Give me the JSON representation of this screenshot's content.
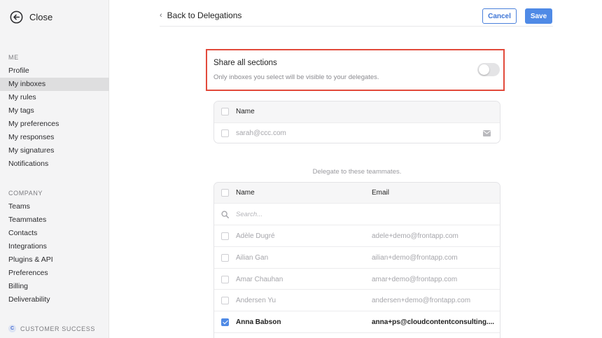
{
  "sidebar": {
    "close_label": "Close",
    "me_label": "ME",
    "me_items": [
      {
        "label": "Profile",
        "active": false
      },
      {
        "label": "My inboxes",
        "active": true
      },
      {
        "label": "My rules",
        "active": false
      },
      {
        "label": "My tags",
        "active": false
      },
      {
        "label": "My preferences",
        "active": false
      },
      {
        "label": "My responses",
        "active": false
      },
      {
        "label": "My signatures",
        "active": false
      },
      {
        "label": "Notifications",
        "active": false
      }
    ],
    "company_label": "COMPANY",
    "company_items": [
      {
        "label": "Teams"
      },
      {
        "label": "Teammates"
      },
      {
        "label": "Contacts"
      },
      {
        "label": "Integrations"
      },
      {
        "label": "Plugins & API"
      },
      {
        "label": "Preferences"
      },
      {
        "label": "Billing"
      },
      {
        "label": "Deliverability"
      }
    ],
    "customer_success": {
      "badge": "C",
      "label": "CUSTOMER SUCCESS"
    }
  },
  "header": {
    "back_label": "Back to Delegations",
    "cancel_label": "Cancel",
    "save_label": "Save"
  },
  "share": {
    "title": "Share all sections",
    "description": "Only inboxes you select will be visible to your delegates.",
    "enabled": false
  },
  "inboxes_table": {
    "header_name": "Name",
    "rows": [
      {
        "name": "sarah@ccc.com",
        "icon": "envelope-icon"
      }
    ]
  },
  "delegate_note": "Delegate to these teammates.",
  "teammates_table": {
    "header_name": "Name",
    "header_email": "Email",
    "search_placeholder": "Search...",
    "rows": [
      {
        "name": "Adèle Dugré",
        "email": "adele+demo@frontapp.com",
        "checked": false
      },
      {
        "name": "Ailian Gan",
        "email": "ailian+demo@frontapp.com",
        "checked": false
      },
      {
        "name": "Amar Chauhan",
        "email": "amar+demo@frontapp.com",
        "checked": false
      },
      {
        "name": "Andersen Yu",
        "email": "andersen+demo@frontapp.com",
        "checked": false
      },
      {
        "name": "Anna Babson",
        "email": "anna+ps@cloudcontentconsulting....",
        "checked": true
      }
    ]
  },
  "colors": {
    "accent": "#4f8ae6",
    "highlight_border": "#e24a3b",
    "sidebar_bg": "#f4f4f5"
  }
}
